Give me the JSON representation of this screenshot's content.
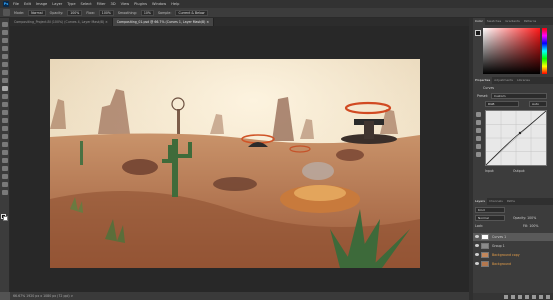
{
  "app": {
    "logo": "Ps"
  },
  "menu": [
    "File",
    "Edit",
    "Image",
    "Layer",
    "Type",
    "Select",
    "Filter",
    "3D",
    "View",
    "Plugins",
    "Window",
    "Help"
  ],
  "options_bar": {
    "mode_label": "Mode:",
    "mode_value": "Normal",
    "opacity_label": "Opacity:",
    "opacity_value": "100%",
    "flow_label": "Flow:",
    "flow_value": "100%",
    "smoothing_label": "Smoothing:",
    "smoothing_value": "10%",
    "sample_label": "Sample:",
    "sample_value": "Current & Below"
  },
  "tabs": [
    {
      "label": "Compositing_Project-BI (100%) (Curves 4, Layer Mask/8) ×",
      "active": false
    },
    {
      "label": "Compositing_01.psd @ 66.7% (Curves 1, Layer Mask/8) ×",
      "active": true
    }
  ],
  "status_bar": {
    "text": "66.67%   1920 px x 1080 px (72 ppi)   >"
  },
  "panels": {
    "color_tabs": [
      "Color",
      "Swatches",
      "Gradients",
      "Patterns"
    ],
    "props_tabs": [
      "Properties",
      "Adjustments",
      "Libraries"
    ],
    "props_title": "Curves",
    "preset_label": "Preset:",
    "preset_value": "Custom",
    "channel_value": "RGB",
    "auto_label": "Auto",
    "input_label": "Input:",
    "output_label": "Output:",
    "layers_tabs": [
      "Layers",
      "Channels",
      "Paths"
    ],
    "kind_label": "Kind",
    "blend_value": "Normal",
    "opacity_label": "Opacity: 100%",
    "lock_label": "Lock:",
    "fill_label": "Fill: 100%",
    "layers": [
      {
        "name": "Curves 1",
        "selected": true
      },
      {
        "name": "Group 1",
        "selected": false
      },
      {
        "name": "Background copy",
        "selected": false
      },
      {
        "name": "Background",
        "selected": false
      }
    ]
  }
}
